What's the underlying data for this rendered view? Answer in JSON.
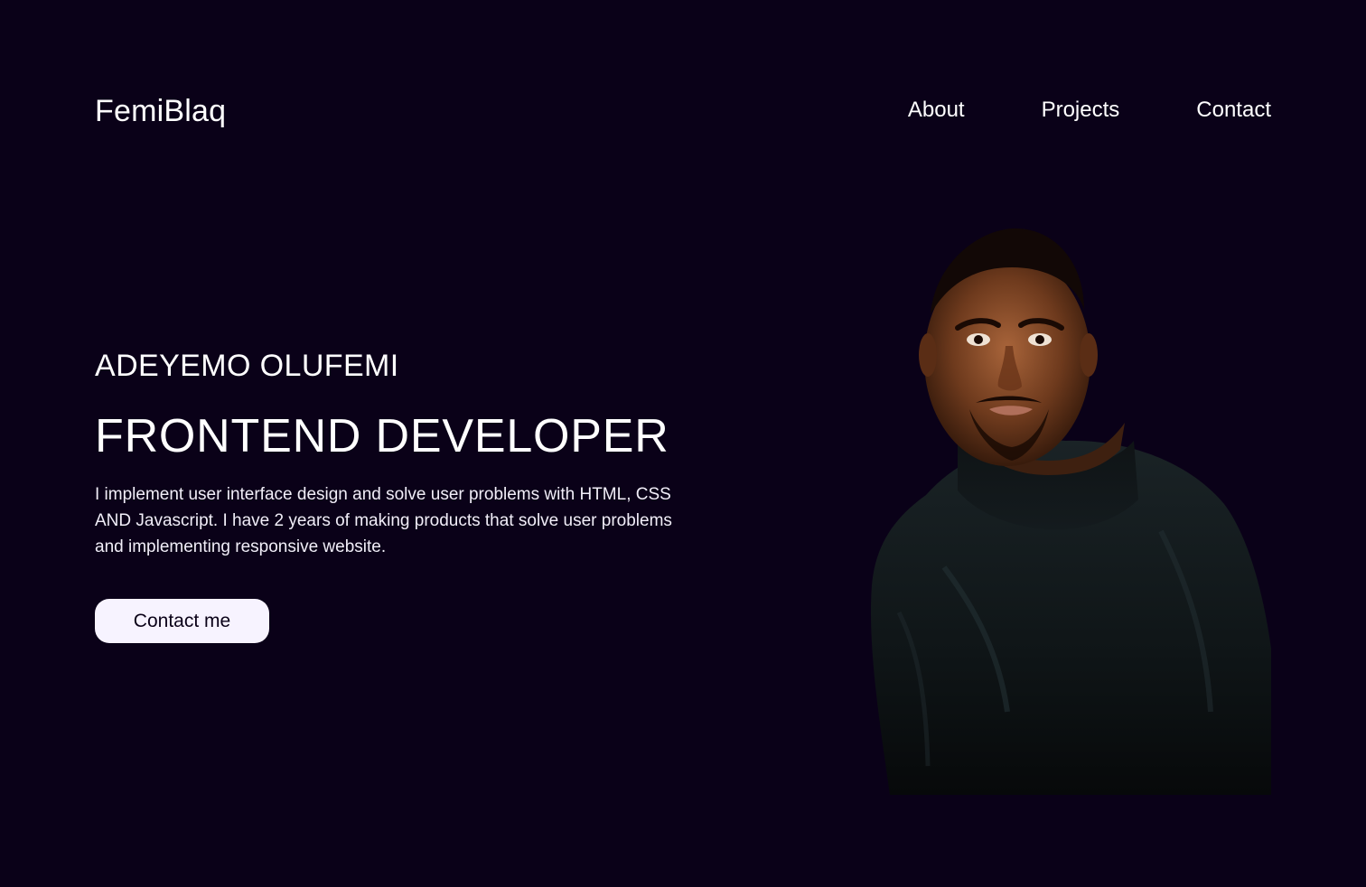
{
  "header": {
    "logo": "FemiBlaq",
    "nav": [
      {
        "label": "About"
      },
      {
        "label": "Projects"
      },
      {
        "label": "Contact"
      }
    ]
  },
  "hero": {
    "name": "ADEYEMO OLUFEMI",
    "role": "FRONTEND DEVELOPER",
    "bio": "I implement user interface design and solve user problems with HTML, CSS AND Javascript. I have 2 years of making products that solve user problems and implementing responsive website.",
    "cta_label": "Contact me",
    "portrait_icon": "portrait-photo"
  },
  "colors": {
    "background": "#0a0118",
    "text": "#ffffff",
    "button_bg": "#f7f3ff",
    "button_text": "#0a0118"
  }
}
